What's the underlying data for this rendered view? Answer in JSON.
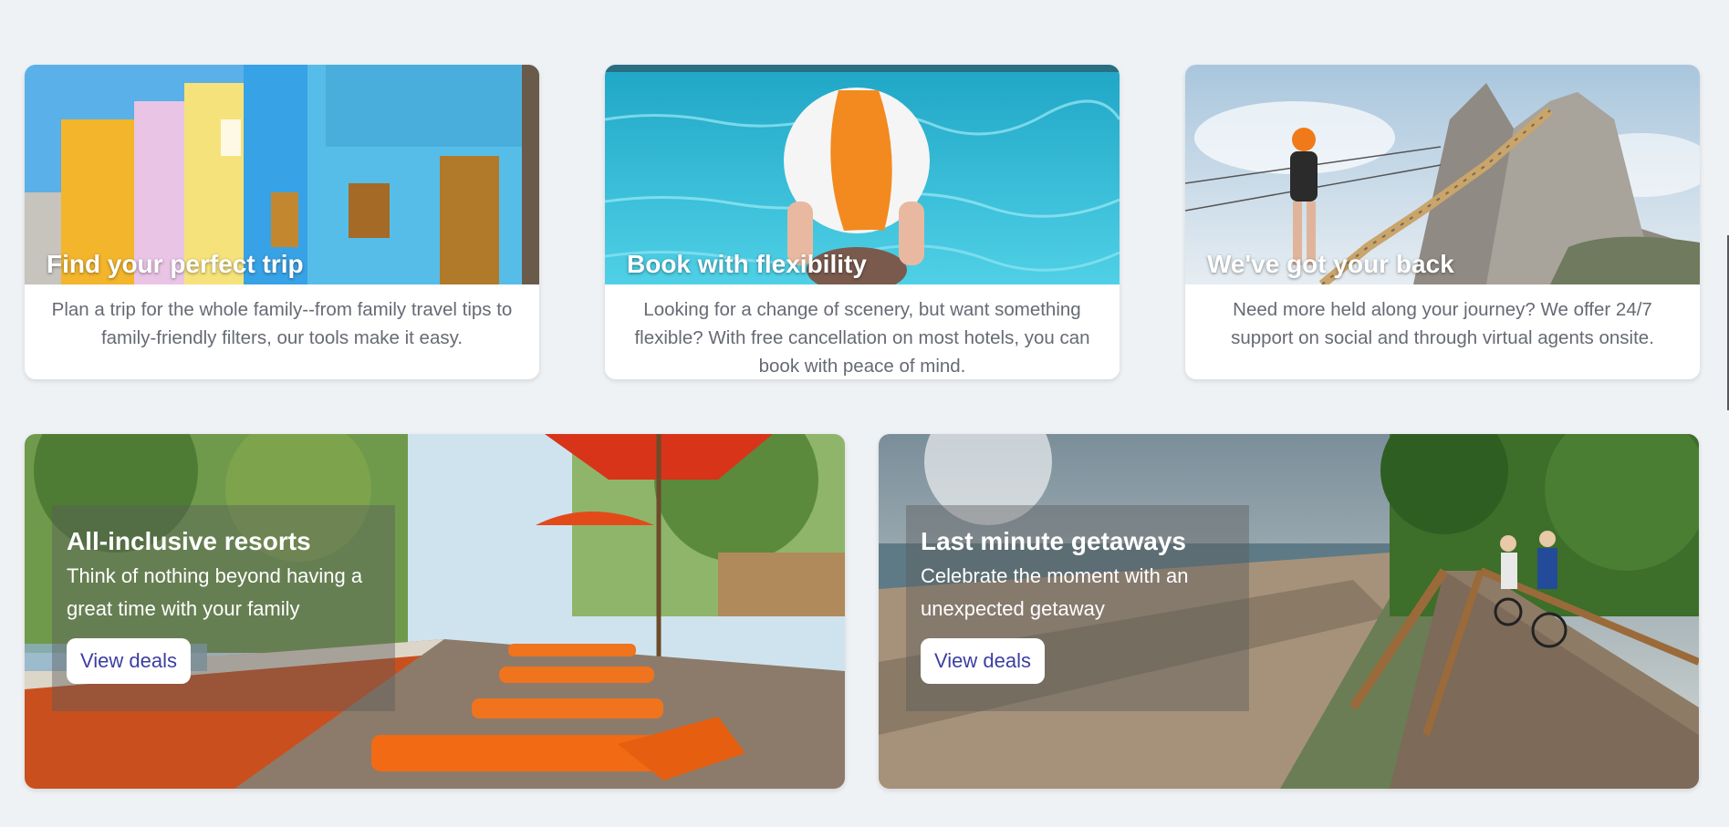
{
  "features": [
    {
      "title": "Find your perfect trip",
      "description": "Plan a trip for the whole family--from family travel tips to family-friendly filters, our tools make it easy."
    },
    {
      "title": "Book with flexibility",
      "description": "Looking for a change of scenery, but want something flexible? With free cancellation on most hotels, you can book with peace of mind."
    },
    {
      "title": "We've got your back",
      "description": "Need more held along your journey? We offer 24/7 support on social and through virtual agents onsite."
    }
  ],
  "promos": [
    {
      "title": "All-inclusive resorts",
      "description": "Think of nothing beyond having a great time with your family",
      "button_label": "View deals"
    },
    {
      "title": "Last minute getaways",
      "description": "Celebrate the moment with an unexpected getaway",
      "button_label": "View deals"
    }
  ],
  "colors": {
    "background": "#eff2f5",
    "button_text": "#3b3fa0",
    "description_text": "#666a73"
  }
}
